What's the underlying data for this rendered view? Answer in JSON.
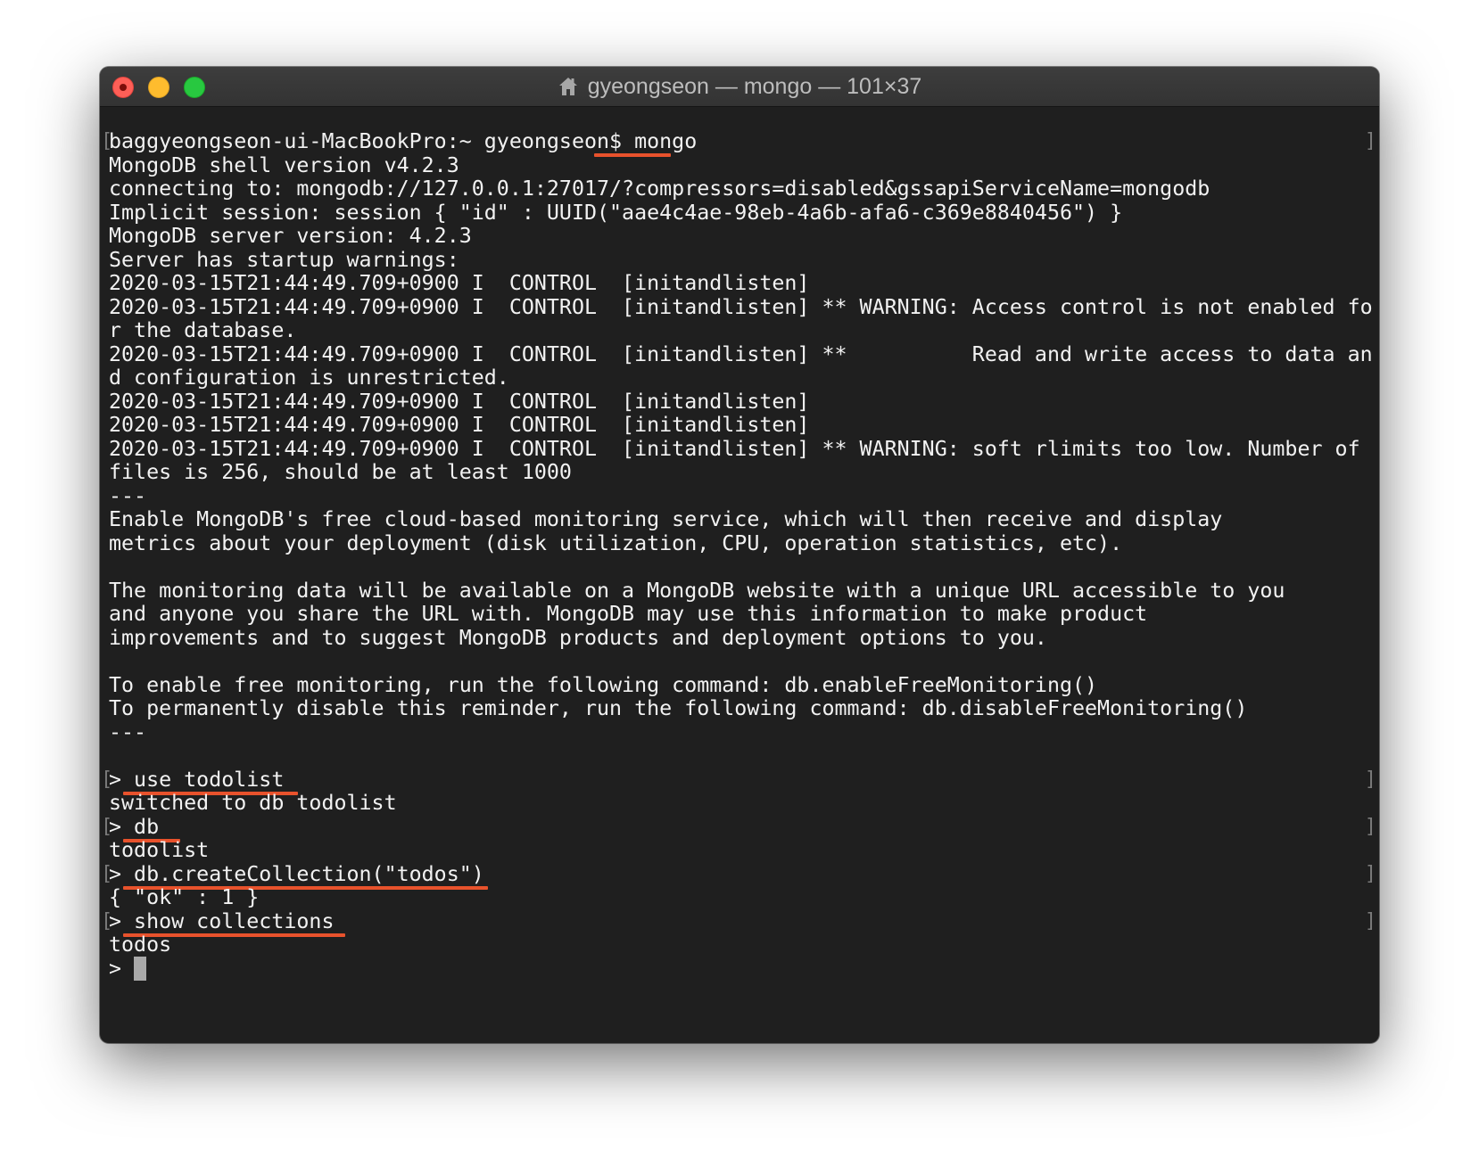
{
  "window": {
    "title": "gyeongseon — mongo — 101×37",
    "title_icon": "home-folder-icon",
    "traffic_lights": [
      "close",
      "minimize",
      "zoom"
    ]
  },
  "colors": {
    "terminal_background": "#1f1f1f",
    "text": "#f2f2f2",
    "annotation_underline": "#e8522c",
    "cursor": "#a9a9a9"
  },
  "terminal": {
    "lines": [
      "baggyeongseon-ui-MacBookPro:~ gyeongseon$ mongo",
      "MongoDB shell version v4.2.3",
      "connecting to: mongodb://127.0.0.1:27017/?compressors=disabled&gssapiServiceName=mongodb",
      "Implicit session: session { \"id\" : UUID(\"aae4c4ae-98eb-4a6b-afa6-c369e8840456\") }",
      "MongoDB server version: 4.2.3",
      "Server has startup warnings:",
      "2020-03-15T21:44:49.709+0900 I  CONTROL  [initandlisten]",
      "2020-03-15T21:44:49.709+0900 I  CONTROL  [initandlisten] ** WARNING: Access control is not enabled fo",
      "r the database.",
      "2020-03-15T21:44:49.709+0900 I  CONTROL  [initandlisten] **          Read and write access to data an",
      "d configuration is unrestricted.",
      "2020-03-15T21:44:49.709+0900 I  CONTROL  [initandlisten]",
      "2020-03-15T21:44:49.709+0900 I  CONTROL  [initandlisten]",
      "2020-03-15T21:44:49.709+0900 I  CONTROL  [initandlisten] ** WARNING: soft rlimits too low. Number of",
      "files is 256, should be at least 1000",
      "---",
      "Enable MongoDB's free cloud-based monitoring service, which will then receive and display",
      "metrics about your deployment (disk utilization, CPU, operation statistics, etc).",
      "",
      "The monitoring data will be available on a MongoDB website with a unique URL accessible to you",
      "and anyone you share the URL with. MongoDB may use this information to make product",
      "improvements and to suggest MongoDB products and deployment options to you.",
      "",
      "To enable free monitoring, run the following command: db.enableFreeMonitoring()",
      "To permanently disable this reminder, run the following command: db.disableFreeMonitoring()",
      "---",
      "",
      "> use todolist",
      "switched to db todolist",
      "> db",
      "todolist",
      "> db.createCollection(\"todos\")",
      "{ \"ok\" : 1 }",
      "> show collections",
      "todos",
      "> "
    ],
    "bracket_marked_lines": [
      0,
      27,
      29,
      31,
      33
    ],
    "underlined_commands": [
      0,
      27,
      29,
      31,
      33
    ]
  }
}
